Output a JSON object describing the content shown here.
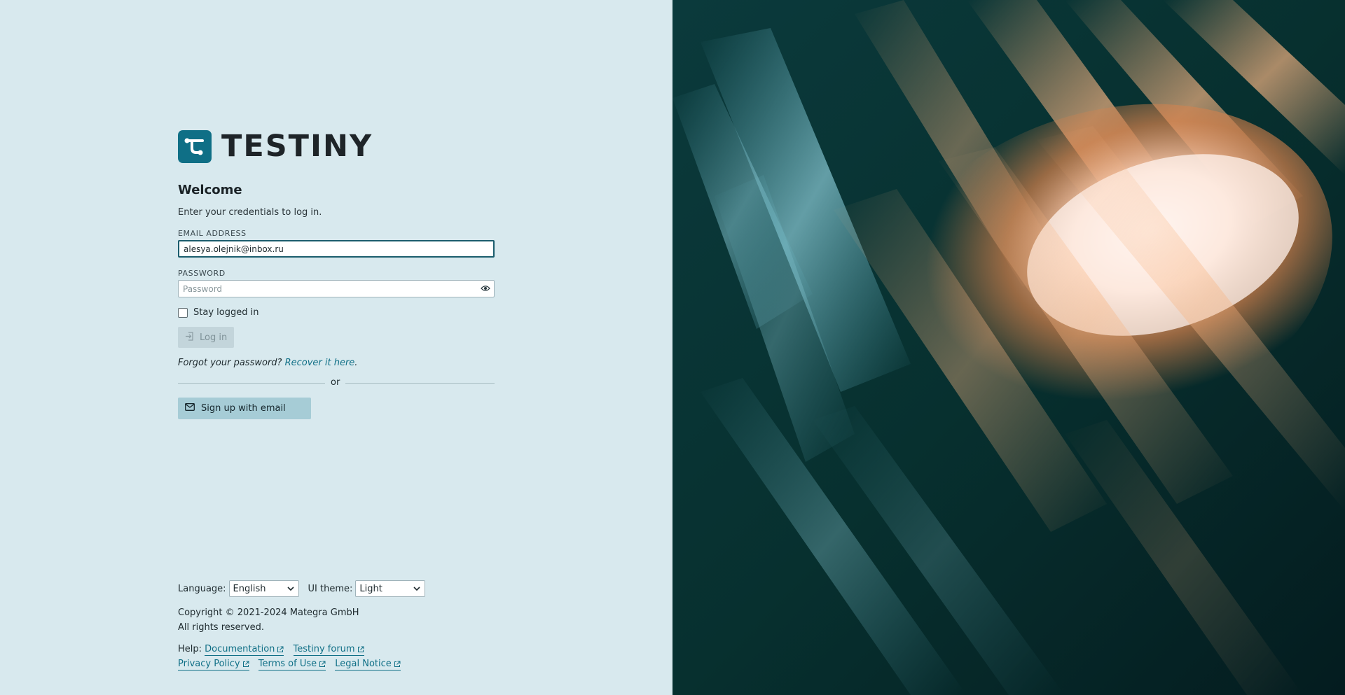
{
  "brand": {
    "name": "TESTINY",
    "accent": "#0f6f86"
  },
  "login": {
    "title": "Welcome",
    "subtitle": "Enter your credentials to log in.",
    "email_label": "EMAIL ADDRESS",
    "email_value": "alesya.olejnik@inbox.ru",
    "password_label": "PASSWORD",
    "password_placeholder": "Password",
    "stay_logged_in": "Stay logged in",
    "login_button": "Log in",
    "forgot_text": "Forgot your password?",
    "recover_link": "Recover it here",
    "recover_suffix": ".",
    "or": "or",
    "signup_button": "Sign up with email"
  },
  "footer": {
    "language_label": "Language:",
    "language_value": "English",
    "theme_label": "UI theme:",
    "theme_value": "Light",
    "copyright_line1": "Copyright © 2021-2024 Mategra GmbH",
    "copyright_line2": "All rights reserved.",
    "help_label": "Help:",
    "links": {
      "documentation": "Documentation",
      "forum": "Testiny forum",
      "privacy": "Privacy Policy",
      "terms": "Terms of Use",
      "legal": "Legal Notice"
    }
  },
  "icons": {
    "eye": "eye-icon",
    "login": "login-icon",
    "mail": "mail-icon",
    "chevron": "chevron-down-icon",
    "external": "external-link-icon"
  }
}
